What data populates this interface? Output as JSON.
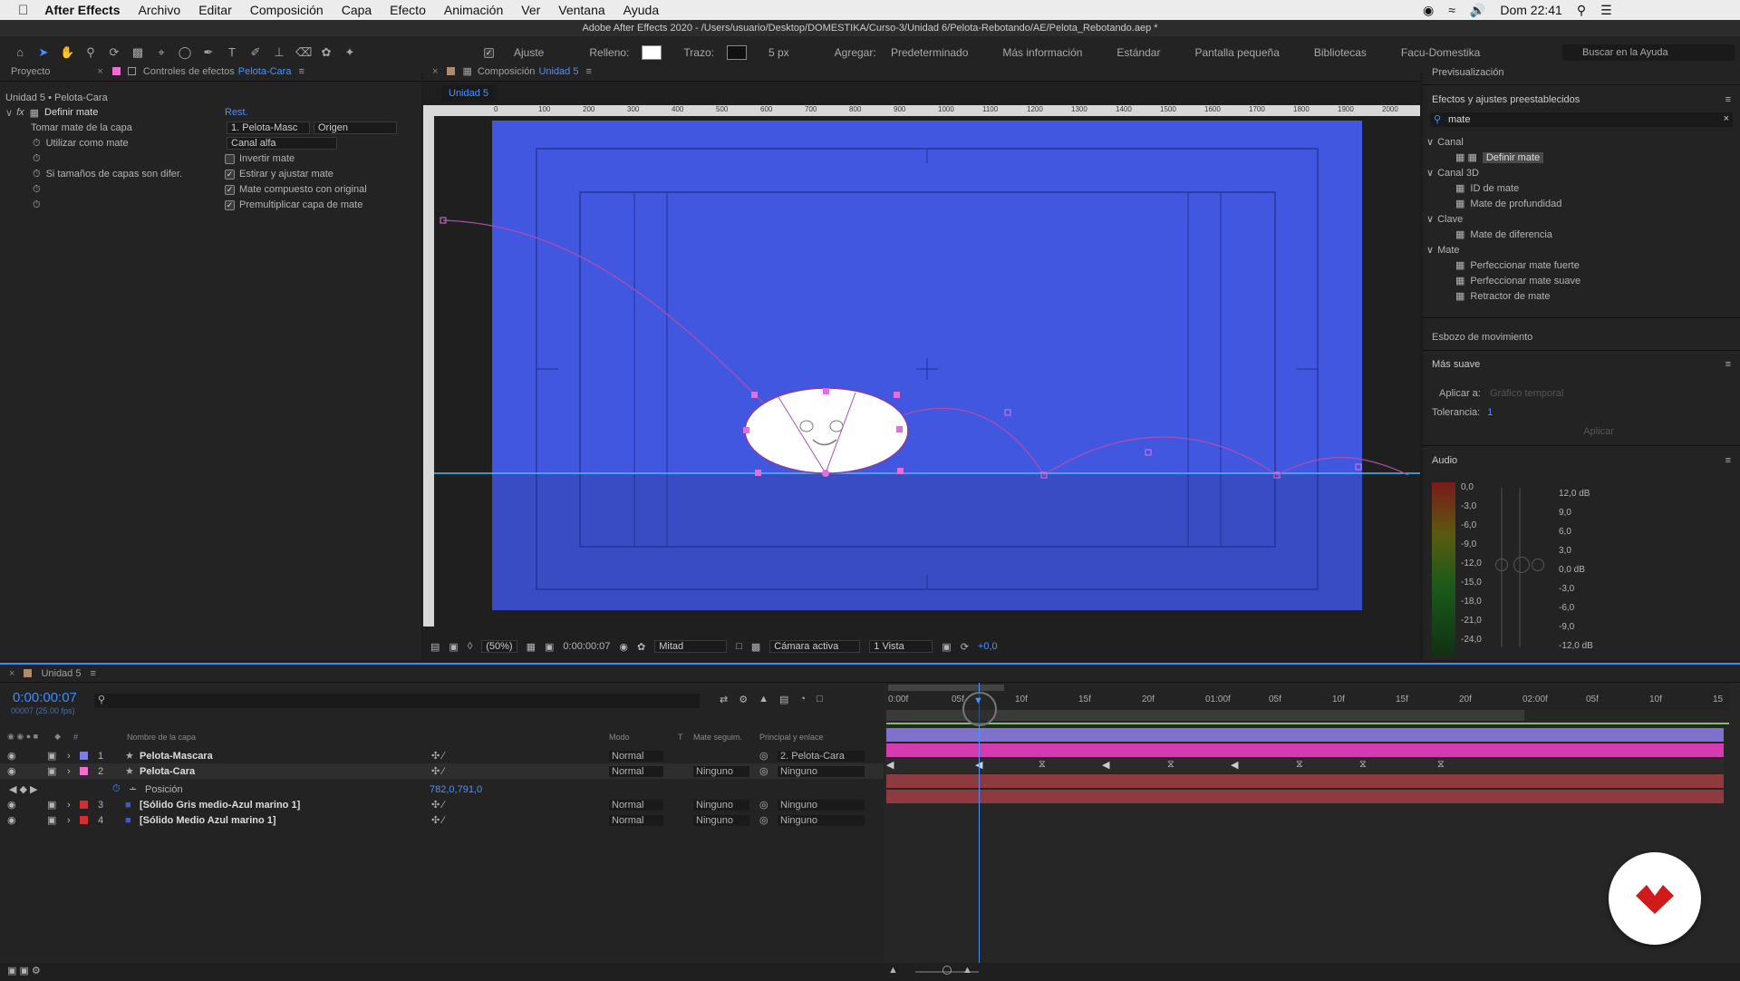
{
  "menubar": {
    "app_name": "After Effects",
    "menus": [
      "Archivo",
      "Editar",
      "Composición",
      "Capa",
      "Efecto",
      "Animación",
      "Ver",
      "Ventana",
      "Ayuda"
    ],
    "clock": "Dom 22:41"
  },
  "window_title": "Adobe After Effects 2020 - /Users/usuario/Desktop/DOMESTIKA/Curso-3/Unidad 6/Pelota-Rebotando/AE/Pelota_Rebotando.aep *",
  "toolbar": {
    "snap_label": "Ajuste",
    "fill_label": "Relleno:",
    "stroke_label": "Trazo:",
    "stroke_px": "5 px",
    "add_label": "Agregar:",
    "workspaces": [
      "Predeterminado",
      "Más información",
      "Estándar",
      "Pantalla pequeña",
      "Bibliotecas",
      "Facu-Domestika"
    ],
    "search_help": "Buscar en la Ayuda",
    "fill_color": "#ffffff",
    "stroke_color": "#111111"
  },
  "left_panel": {
    "tab_project": "Proyecto",
    "tab_effects": "Controles de efectos",
    "tab_effects_layer": "Pelota-Cara",
    "breadcrumb": "Unidad 5 • Pelota-Cara",
    "effect_name": "Definir mate",
    "reset": "Rest.",
    "props": {
      "take_matte_label": "Tomar mate de la capa",
      "take_matte_value": "1. Pelota-Masc",
      "take_matte_value2": "Origen",
      "use_as_label": "Utilizar como mate",
      "use_as_value": "Canal alfa",
      "invert_label": "Invertir mate",
      "size_label": "Si tamaños de capas son difer.",
      "stretch_label": "Estirar y ajustar mate",
      "composite_label": "Mate compuesto con original",
      "premultiply_label": "Premultiplicar capa de mate"
    }
  },
  "comp_panel": {
    "tab_label": "Composición",
    "comp_name": "Unidad 5",
    "subtab": "Unidad 5",
    "ruler_ticks": [
      "0",
      "100",
      "200",
      "300",
      "400",
      "500",
      "600",
      "700",
      "800",
      "900",
      "1000",
      "1100",
      "1200",
      "1300",
      "1400",
      "1500",
      "1600",
      "1700",
      "1800",
      "1900",
      "2000"
    ],
    "zoom": "(50%)",
    "timecode": "0:00:00:07",
    "resolution": "Mitad",
    "camera": "Cámara activa",
    "views": "1 Vista",
    "exposure": "+0,0",
    "bg_color": "#4257e0"
  },
  "right_panel": {
    "preview": "Previsualización",
    "effects_presets": "Efectos y ajustes preestablecidos",
    "search_value": "mate",
    "categories": [
      {
        "name": "Canal",
        "items": [
          "Definir mate"
        ]
      },
      {
        "name": "Canal 3D",
        "items": [
          "ID de mate",
          "Mate de profundidad"
        ]
      },
      {
        "name": "Clave",
        "items": [
          "Mate de diferencia"
        ]
      },
      {
        "name": "Mate",
        "items": [
          "Perfeccionar mate fuerte",
          "Perfeccionar mate suave",
          "Retractor de mate"
        ]
      }
    ],
    "motion_sketch": "Esbozo de movimiento",
    "smoother": "Más suave",
    "apply_to_label": "Aplicar a:",
    "apply_to_value": "Gráfico temporal",
    "tolerance_label": "Tolerancia:",
    "tolerance_value": "1",
    "apply_button": "Aplicar",
    "audio": "Audio",
    "db_left": [
      "0,0",
      "-3,0",
      "-6,0",
      "-9,0",
      "-12,0",
      "-15,0",
      "-18,0",
      "-21,0",
      "-24,0"
    ],
    "db_right": [
      "12,0 dB",
      "9,0",
      "6,0",
      "3,0",
      "0,0 dB",
      "-3,0",
      "-6,0",
      "-9,0",
      "-12,0 dB"
    ]
  },
  "timeline": {
    "tab": "Unidad 5",
    "timecode": "0:00:00:07",
    "frame_info": "00007 (25.00 fps)",
    "col_name": "Nombre de la capa",
    "col_mode": "Modo",
    "col_t": "T",
    "col_track": "Mate seguim.",
    "col_parent": "Principal y enlace",
    "ruler": [
      "0:00f",
      "05f",
      "10f",
      "15f",
      "20f",
      "01:00f",
      "05f",
      "10f",
      "15f",
      "20f",
      "02:00f",
      "05f",
      "10f",
      "15"
    ],
    "position_label": "Posición",
    "position_value": "782,0,791,0",
    "layers": [
      {
        "num": "1",
        "name": "Pelota-Mascara",
        "mode": "Normal",
        "track": "",
        "parent": "2. Pelota-Cara",
        "color": "#7b7cf0",
        "bar": "#8a7fd0"
      },
      {
        "num": "2",
        "name": "Pelota-Cara",
        "mode": "Normal",
        "track": "Ninguno",
        "parent": "Ninguno",
        "color": "#ee6fd0",
        "bar": "#d53bb0"
      },
      {
        "num": "3",
        "name": "[Sólido Gris medio-Azul marino 1]",
        "mode": "Normal",
        "track": "Ninguno",
        "parent": "Ninguno",
        "color": "#d03030",
        "bar": "#9a3a3e"
      },
      {
        "num": "4",
        "name": "[Sólido Medio Azul marino 1]",
        "mode": "Normal",
        "track": "Ninguno",
        "parent": "Ninguno",
        "color": "#d03030",
        "bar": "#9a3a3e"
      }
    ]
  }
}
